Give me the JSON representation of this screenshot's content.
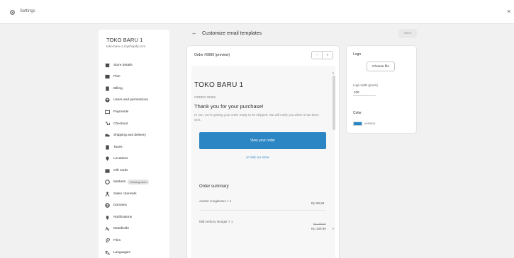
{
  "topbar": {
    "title": "Settings",
    "close": "×"
  },
  "sidebar": {
    "store_name": "TOKO BARU 1",
    "store_url": "toko-baru-1.myshopify.com",
    "items": [
      {
        "label": "Store details",
        "icon": "store-icon"
      },
      {
        "label": "Plan",
        "icon": "plan-icon"
      },
      {
        "label": "Billing",
        "icon": "billing-icon"
      },
      {
        "label": "Users and permissions",
        "icon": "users-icon"
      },
      {
        "label": "Payments",
        "icon": "payments-icon"
      },
      {
        "label": "Checkout",
        "icon": "checkout-icon"
      },
      {
        "label": "Shipping and delivery",
        "icon": "shipping-icon"
      },
      {
        "label": "Taxes",
        "icon": "taxes-icon"
      },
      {
        "label": "Locations",
        "icon": "location-icon"
      },
      {
        "label": "Gift cards",
        "icon": "gift-card-icon"
      },
      {
        "label": "Markets",
        "icon": "markets-icon",
        "badge": "Coming soon"
      },
      {
        "label": "Sales channels",
        "icon": "sales-channels-icon"
      },
      {
        "label": "Domains",
        "icon": "domains-icon"
      },
      {
        "label": "Notifications",
        "icon": "notifications-icon"
      },
      {
        "label": "Metafields",
        "icon": "metafields-icon"
      },
      {
        "label": "Files",
        "icon": "files-icon"
      },
      {
        "label": "Languages",
        "icon": "languages-icon"
      }
    ]
  },
  "header": {
    "back": "←",
    "title": "Customize email templates",
    "save": "Save"
  },
  "preview": {
    "order_label": "Order #9999 (preview)",
    "pager_prev": "‹",
    "pager_next": "›",
    "email": {
      "store_name": "TOKO BARU 1",
      "order_id": "ORDER #9999",
      "heading": "Thank you for your purchase!",
      "body": "Hi Jon, we're getting your order ready to be shipped. We will notify you when it has been sent.",
      "view_order": "View your order",
      "visit_store": "or Visit our store",
      "summary_title": "Order summary",
      "items": [
        {
          "name": "Aviator sunglasses × 1",
          "price": "Rp 89,99"
        },
        {
          "name": "Mid-century lounger × 1",
          "price": "Rp 159,99",
          "compare": "Rp 199,99"
        }
      ]
    }
  },
  "settings_panel": {
    "logo_label": "Logo",
    "choose_file": "Choose file",
    "logo_width_label": "Logo width (pixels)",
    "logo_width_value": "100",
    "color_label": "Color",
    "accent_color": "#1f87c8",
    "accent_hex": "#1990C6"
  }
}
